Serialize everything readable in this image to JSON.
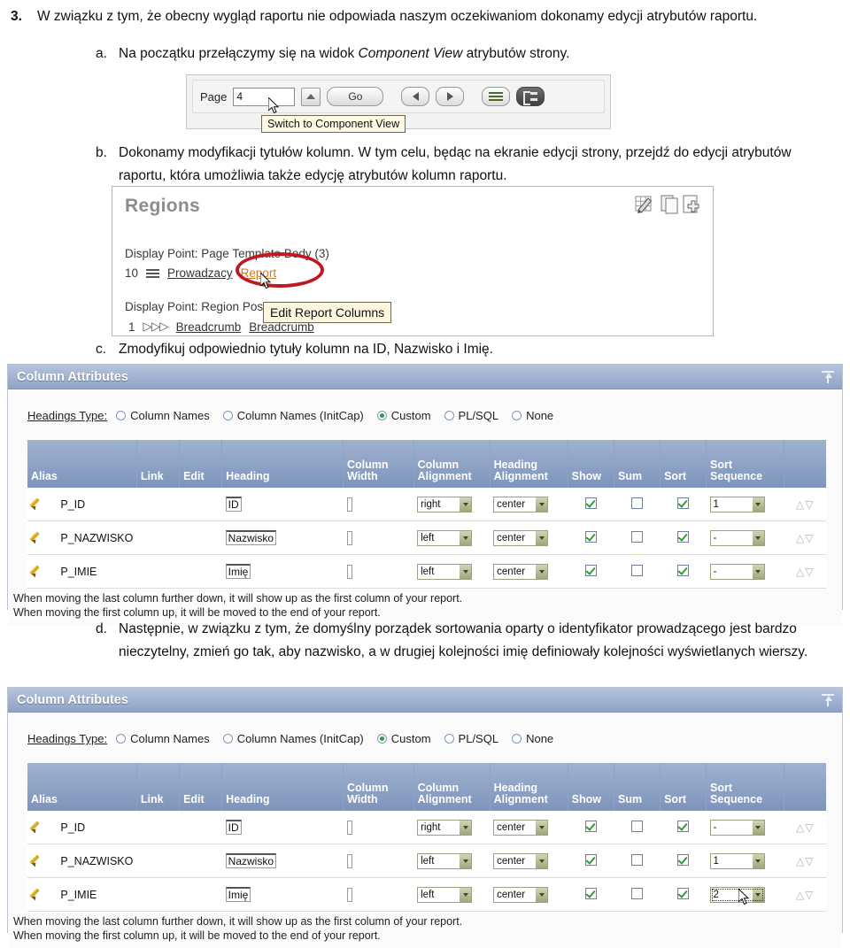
{
  "document": {
    "items": [
      {
        "marker": "3.",
        "text": "W związku z tym, że obecny wygląd raportu nie odpowiada naszym oczekiwaniom dokonamy edycji atrybutów raportu."
      },
      {
        "marker": "a.",
        "text_before": "Na początku przełączymy się na widok ",
        "text_italic": "Component View",
        "text_after": " atrybutów strony."
      },
      {
        "marker": "b.",
        "text": "Dokonamy modyfikacji tytułów kolumn. W tym celu, będąc na ekranie edycji strony, przejdź do edycji atrybutów raportu, która umożliwia także edycję atrybutów kolumn raportu."
      },
      {
        "marker": "c.",
        "text": "Zmodyfikuj odpowiednio tytuły kolumn na ID, Nazwisko i Imię."
      },
      {
        "marker": "d.",
        "text": "Następnie, w związku z tym, że domyślny porządek sortowania oparty o identyfikator prowadzącego jest bardzo nieczytelny, zmień go tak, aby nazwisko, a w drugiej kolejności imię definiowały kolejności wyświetlanych wierszy."
      }
    ]
  },
  "toolbar_screenshot": {
    "page_label": "Page",
    "page_value": "4",
    "spinner_icon": "spinner-up-icon",
    "go_label": "Go",
    "prev_icon": "previous-page-icon",
    "next_icon": "next-page-icon",
    "tree_view_icon": "tree-view-icon",
    "component_view_icon": "component-view-icon",
    "tooltip": "Switch to Component View",
    "cursor_icon": "mouse-pointer-icon"
  },
  "regions_screenshot": {
    "title": "Regions",
    "icons": [
      "edit-grid-icon",
      "copy-icon",
      "add-icon"
    ],
    "display_point_1": "Display Point: Page Template Body (3)",
    "row_1": {
      "seq": "10",
      "type_icon": "report-rows-icon",
      "name": "Prowadzacy",
      "link": "Report"
    },
    "display_point_2": "Display Point: Region Position 01",
    "row_2": {
      "seq": "1",
      "type_icon": "breadcrumb-arrows-icon",
      "name": "Breadcrumb",
      "link": "Breadcrumb"
    },
    "highlight_shape": "red-ellipse-annotation",
    "tooltip": "Edit Report Columns",
    "cursor_icon": "mouse-pointer-icon"
  },
  "column_attributes_panel_1": {
    "title": "Column Attributes",
    "collapse_icon": "collapse-up-icon",
    "headings_type_label": "Headings Type:",
    "headings_options": [
      {
        "label": "Column Names",
        "selected": false
      },
      {
        "label": "Column Names (InitCap)",
        "selected": false
      },
      {
        "label": "Custom",
        "selected": true
      },
      {
        "label": "PL/SQL",
        "selected": false
      },
      {
        "label": "None",
        "selected": false
      }
    ],
    "table_headers": [
      "Alias",
      "Link",
      "Edit",
      "Heading",
      "Column\nWidth",
      "Column\nAlignment",
      "Heading\nAlignment",
      "Show",
      "Sum",
      "Sort",
      "Sort\nSequence",
      ""
    ],
    "rows": [
      {
        "edit_icon": "pencil-icon",
        "alias": "P_ID",
        "link": "",
        "edit": "",
        "heading": "ID",
        "column_width": "",
        "column_alignment": "right",
        "heading_alignment": "center",
        "show": true,
        "sum": false,
        "sort": true,
        "sort_sequence": "1",
        "sort_sequence_focused": false,
        "reorder_icons": "up-down-arrows-icon"
      },
      {
        "edit_icon": "pencil-icon",
        "alias": "P_NAZWISKO",
        "link": "",
        "edit": "",
        "heading": "Nazwisko",
        "column_width": "",
        "column_alignment": "left",
        "heading_alignment": "center",
        "show": true,
        "sum": false,
        "sort": true,
        "sort_sequence": "-",
        "sort_sequence_focused": false,
        "reorder_icons": "up-down-arrows-icon"
      },
      {
        "edit_icon": "pencil-icon",
        "alias": "P_IMIE",
        "link": "",
        "edit": "",
        "heading": "Imię",
        "column_width": "",
        "column_alignment": "left",
        "heading_alignment": "center",
        "show": true,
        "sum": false,
        "sort": true,
        "sort_sequence": "-",
        "sort_sequence_focused": false,
        "reorder_icons": "up-down-arrows-icon"
      }
    ],
    "note_line_1": "When moving the last column further down, it will show up as the first column of your report.",
    "note_line_2": "When moving the first column up, it will be moved to the end of your report."
  },
  "column_attributes_panel_2": {
    "title": "Column Attributes",
    "collapse_icon": "collapse-up-icon",
    "headings_type_label": "Headings Type:",
    "headings_options": [
      {
        "label": "Column Names",
        "selected": false
      },
      {
        "label": "Column Names (InitCap)",
        "selected": false
      },
      {
        "label": "Custom",
        "selected": true
      },
      {
        "label": "PL/SQL",
        "selected": false
      },
      {
        "label": "None",
        "selected": false
      }
    ],
    "table_headers": [
      "Alias",
      "Link",
      "Edit",
      "Heading",
      "Column\nWidth",
      "Column\nAlignment",
      "Heading\nAlignment",
      "Show",
      "Sum",
      "Sort",
      "Sort\nSequence",
      ""
    ],
    "rows": [
      {
        "edit_icon": "pencil-icon",
        "alias": "P_ID",
        "link": "",
        "edit": "",
        "heading": "ID",
        "column_width": "",
        "column_alignment": "right",
        "heading_alignment": "center",
        "show": true,
        "sum": false,
        "sort": true,
        "sort_sequence": "-",
        "sort_sequence_focused": false,
        "reorder_icons": "up-down-arrows-icon"
      },
      {
        "edit_icon": "pencil-icon",
        "alias": "P_NAZWISKO",
        "link": "",
        "edit": "",
        "heading": "Nazwisko",
        "column_width": "",
        "column_alignment": "left",
        "heading_alignment": "center",
        "show": true,
        "sum": false,
        "sort": true,
        "sort_sequence": "1",
        "sort_sequence_focused": false,
        "reorder_icons": "up-down-arrows-icon"
      },
      {
        "edit_icon": "pencil-icon",
        "alias": "P_IMIE",
        "link": "",
        "edit": "",
        "heading": "Imię",
        "column_width": "",
        "column_alignment": "left",
        "heading_alignment": "center",
        "show": true,
        "sum": false,
        "sort": true,
        "sort_sequence": "2",
        "sort_sequence_focused": true,
        "reorder_icons": "up-down-arrows-icon"
      }
    ],
    "note_line_1": "When moving the last column further down, it will show up as the first column of your report.",
    "note_line_2": "When moving the first column up, it will be moved to the end of your report.",
    "cursor_icon": "mouse-pointer-icon"
  },
  "colors": {
    "panel_header_from": "#b6c4dd",
    "panel_header_to": "#8fa3c6",
    "table_header_from": "#9fb2d0",
    "table_header_to": "#7d94bb",
    "checkbox_check": "#2f9c3a",
    "radio_selected": "#2f9c3a",
    "highlight_link": "#cc7a22",
    "annotation_ellipse": "#c0181f",
    "tooltip_background": "#fdf9e4"
  }
}
